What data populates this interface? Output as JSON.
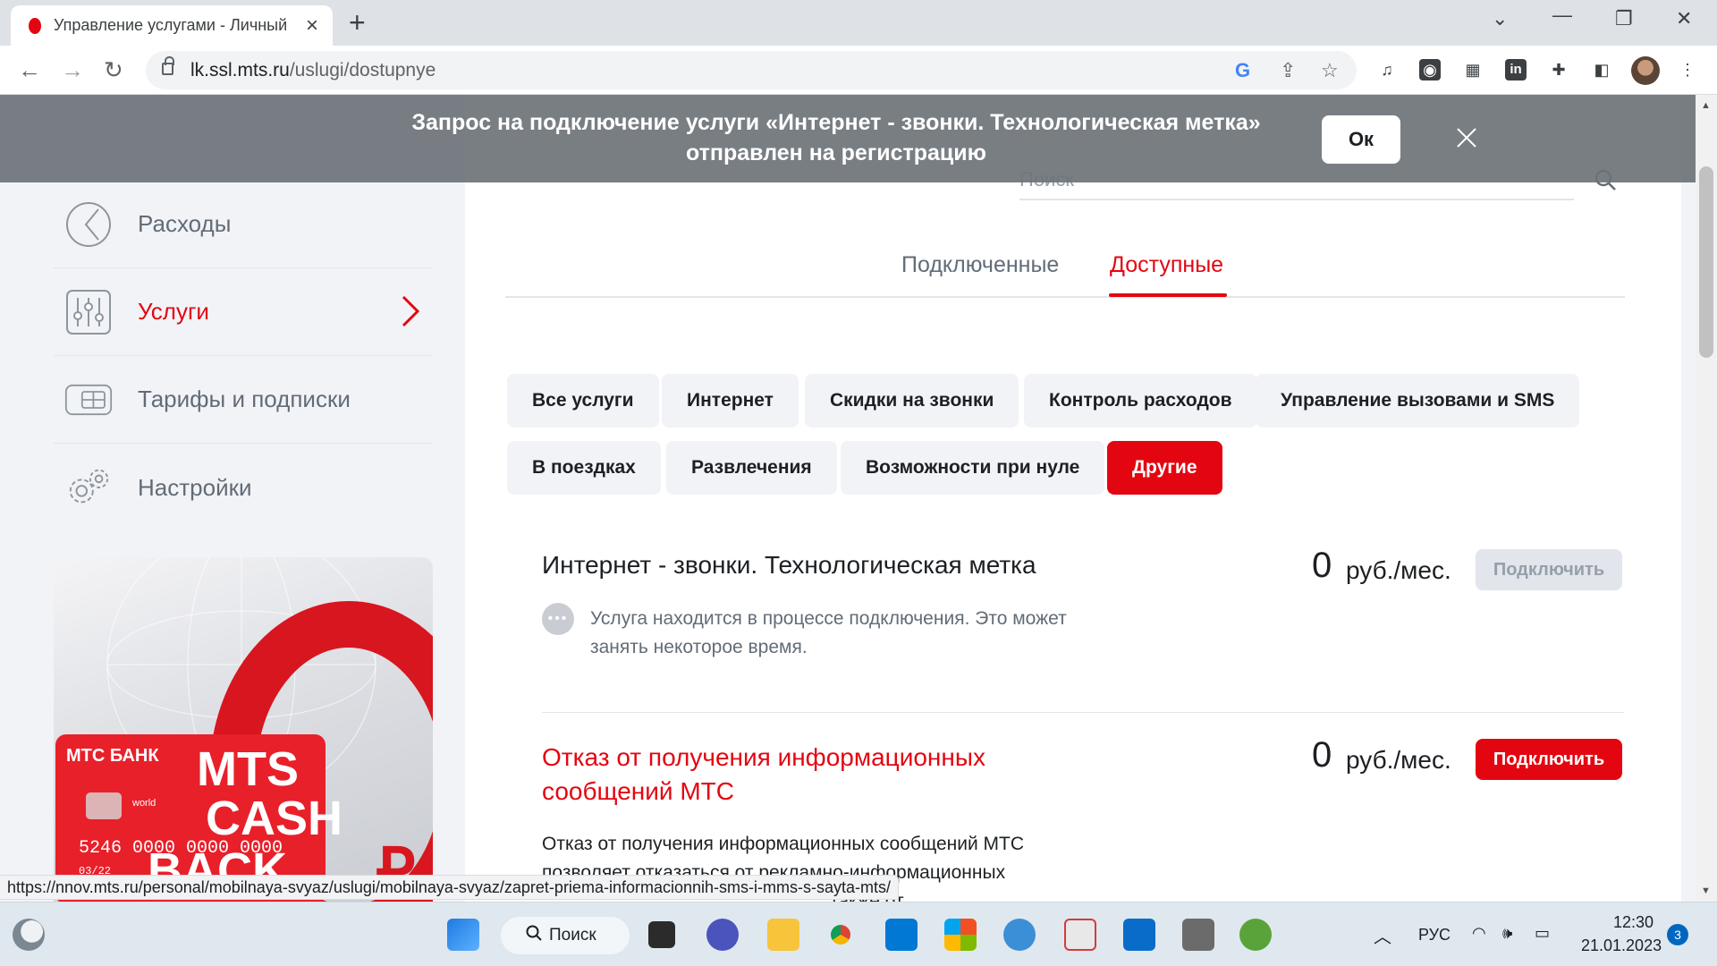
{
  "browser": {
    "tab_title": "Управление услугами - Личный",
    "url_host": "lk.ssl.mts.ru",
    "url_path": "/uslugi/dostupnye"
  },
  "notification": {
    "text_line1": "Запрос на подключение услуги «Интернет - звонки. Технологическая метка»",
    "text_line2": "отправлен на регистрацию",
    "ok_label": "Ок"
  },
  "sidebar": {
    "items": [
      {
        "label": "Расходы",
        "icon": "pie-chart-icon"
      },
      {
        "label": "Услуги",
        "icon": "sliders-icon"
      },
      {
        "label": "Тарифы и подписки",
        "icon": "card-icon"
      },
      {
        "label": "Настройки",
        "icon": "gear-icon"
      }
    ],
    "promo_card": {
      "bank": "МТС БАНК",
      "brand_line1": "MTS",
      "brand_line2": "CASH",
      "brand_line3": "BACK",
      "number": "5246 0000 0000 0000",
      "small": "world",
      "expiry": "03/22"
    }
  },
  "search": {
    "placeholder": "Поиск"
  },
  "tabs": [
    {
      "label": "Подключенные"
    },
    {
      "label": "Доступные"
    }
  ],
  "chips": [
    "Все услуги",
    "Интернет",
    "Скидки на звонки",
    "Контроль расходов",
    "Управление вызовами и SMS",
    "В поездках",
    "Развлечения",
    "Возможности при нуле",
    "Другие"
  ],
  "services": [
    {
      "title": "Интернет - звонки. Технологическая метка",
      "price": "0",
      "unit": "руб./мес.",
      "button": "Подключить",
      "note": "Услуга находится в процессе подключения. Это может занять некоторое время."
    },
    {
      "title_line1": "Отказ от получения информационных",
      "title_line2": "сообщений МТС",
      "price": "0",
      "unit": "руб./мес.",
      "button": "Подключить",
      "desc_line1": "Отказ от получения информационных сообщений МТС",
      "desc_line2": "позволяет отказаться от рекламно-информационных",
      "desc_line3": "также от"
    }
  ],
  "status_bar_url": "https://nnov.mts.ru/personal/mobilnaya-svyaz/uslugi/mobilnaya-svyaz/zapret-priema-informacionnih-sms-i-mms-s-sayta-mts/",
  "taskbar": {
    "search_label": "Поиск",
    "lang": "РУС",
    "time": "12:30",
    "date": "21.01.2023",
    "badge": "3"
  },
  "colors": {
    "accent": "#e30611",
    "text": "#1d2023",
    "muted": "#626c77"
  }
}
